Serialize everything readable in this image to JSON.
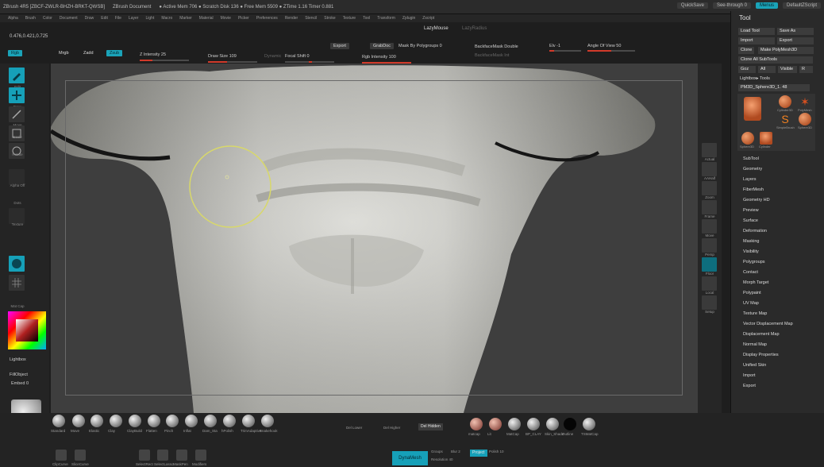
{
  "titlebar": {
    "app": "ZBrush 4R5 [ZBCF-ZWLR-BHZH-BRKT-QWSB]",
    "doc": "ZBrush Document",
    "stats": "● Active Mem 706 ● Scratch Disk 136 ● Free Mem 5509 ● ZTime 1.16 Timer 0.881",
    "quicksave": "QuickSave",
    "seethrough": "See-through  0",
    "menus": "Menus",
    "script": "DefaultZScript"
  },
  "menubar": [
    "Alpha",
    "Brush",
    "Color",
    "Document",
    "Draw",
    "Edit",
    "File",
    "Layer",
    "Light",
    "Macro",
    "Marker",
    "Material",
    "Movie",
    "Picker",
    "Preferences",
    "Render",
    "Stencil",
    "Stroke",
    "Texture",
    "Tool",
    "Transform",
    "Zplugin",
    "Zscript"
  ],
  "coords": "0.476,0.421,0.725",
  "lazymouse": "LazyMouse",
  "lazyoff": "LazyRadius",
  "toolstrip": {
    "rgb": "Rgb",
    "mrgb": "Mrgb",
    "zadd": "Zadd",
    "zsub": "Zsub",
    "zintensity": "Z Intensity 25",
    "drawsize": "Draw Size 109",
    "dynamic": "Dynamic",
    "focalshift": "Focal Shift 0",
    "rgbint": "Rgb Intensity 100",
    "export": "Export",
    "grabdoc": "GrabDoc",
    "maskpoly": "Mask By Polygroups 0",
    "backface": "BackfaceMask  Double",
    "elv": "Elv -1",
    "angle": "Angle Of View 50",
    "backfaceint": "BackfaceMask Int"
  },
  "leftshelf": {
    "labels": [
      "Edit",
      "Draw",
      "Move",
      "Scale",
      "Rotate",
      "Alpha Off",
      "Dots",
      "Texture",
      "Mat Cap",
      "Lightbox",
      "FillObject",
      "Embed 0",
      "MatCap"
    ]
  },
  "rightshelf": {
    "labels": [
      "Actual",
      "AAHalf",
      "Zoom",
      "Frame",
      "Move",
      "Persp",
      "Floor",
      "Local",
      "Setup"
    ]
  },
  "panel": {
    "title": "Tool",
    "buttons": [
      "Load Tool",
      "Save As",
      "Import",
      "Export",
      "Clone",
      "Make PolyMesh3D",
      "Clone All SubTools",
      "Goz",
      "All",
      "Visible",
      "R"
    ],
    "lightbox": "Lightbox▸ Tools",
    "current": "PM3D_Sphere3D_1. 48",
    "thumbs": [
      "PM3D_Sphere",
      "Cylinder3D",
      "PolyMesh",
      "SimpleBrush",
      "Sphere3D",
      "Sphere3D",
      "Cylinder"
    ],
    "items": [
      "SubTool",
      "Geometry",
      "Layers",
      "FiberMesh",
      "Geometry HD",
      "Preview",
      "Surface",
      "Deformation",
      "Masking",
      "Visibility",
      "Polygroups",
      "Contact",
      "Morph Target",
      "Polypaint",
      "UV Map",
      "Texture Map",
      "Vector Displacement Map",
      "Displacement Map",
      "Normal Map",
      "Display Properties",
      "Unified Skin",
      "Import",
      "Export"
    ]
  },
  "bottom": {
    "brushes": [
      "Standard",
      "Move",
      "Elastic",
      "Clay",
      "ClayBuild",
      "Flatten",
      "Pinch",
      "Inflat",
      "Dam_Sta",
      "hPolish",
      "TrimAdaptive",
      "Snakehook"
    ],
    "materials": [
      "matcap",
      "Lit",
      "MatCap",
      "BP_CLAY",
      "Skin_Shade",
      "Outline",
      "TSMatCap"
    ],
    "delower": "Del Lower",
    "delhigher": "Del Higher",
    "delhidden": "Del Hidden",
    "dynamesh": "DynaMesh",
    "groups": "Groups",
    "blur": "Blur 2",
    "project": "Project",
    "polish": "Polish 10",
    "resolution": "Resolution 40",
    "extra": [
      "ClipCurve",
      "SliceCurve",
      "SelectRect",
      "SelectLasso",
      "MaskPen",
      "Modifiers"
    ]
  }
}
